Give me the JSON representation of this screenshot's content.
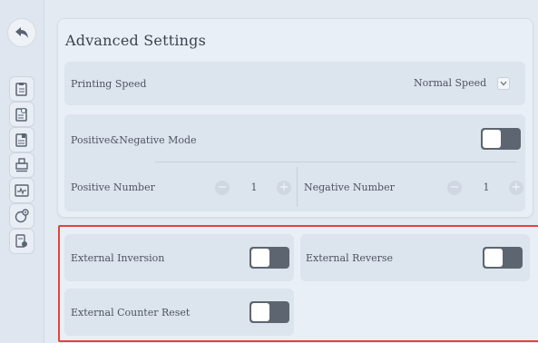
{
  "panel": {
    "title": "Advanced Settings",
    "printing_speed": {
      "label": "Printing Speed",
      "value": "Normal Speed"
    },
    "pn_mode": {
      "label": "Positive&Negative Mode",
      "enabled": false
    },
    "positive_number": {
      "label": "Positive Number",
      "value": "1"
    },
    "negative_number": {
      "label": "Negative Number",
      "value": "1"
    }
  },
  "external": {
    "inversion": {
      "label": "External Inversion",
      "enabled": false
    },
    "reverse": {
      "label": "External Reverse",
      "enabled": false
    },
    "counter_reset": {
      "label": "External Counter Reset",
      "enabled": false
    }
  },
  "sidebar": {
    "icons": [
      "back-arrow-icon",
      "document-icon",
      "settings-doc-icon",
      "doc-list-icon",
      "printer-icon",
      "waveform-icon",
      "network-gear-icon",
      "tag-icon"
    ]
  },
  "colors": {
    "highlight_border": "#e2443c",
    "toggle_track": "#5d6670"
  }
}
